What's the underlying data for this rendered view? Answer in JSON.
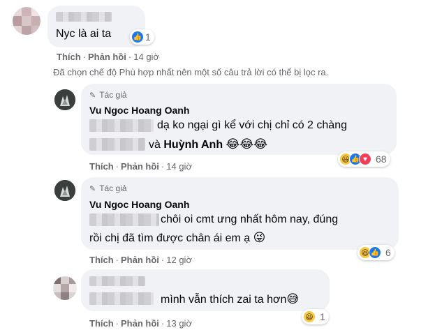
{
  "comment1": {
    "text": "Nyc là ai ta",
    "reaction_count": "1",
    "like_label": "Thích",
    "reply_label": "Phản hồi",
    "time": "14 giờ"
  },
  "filter_notice": "Đã chọn chế độ Phù hợp nhất nên một số câu trả lời có thể bị lọc ra.",
  "reply1": {
    "author_tag": "Tác giả",
    "author": "Vu Ngoc Hoang Oanh",
    "line1": "dạ ko ngại gì kể với chị chỉ có 2 chàng",
    "line2_prefix": "và",
    "mention": "Huỳnh Anh",
    "emojis": "😂😂😂",
    "reaction_count": "68",
    "like_label": "Thích",
    "reply_label": "Phản hồi",
    "time": "14 giờ"
  },
  "reply2": {
    "author_tag": "Tác giả",
    "author": "Vu Ngoc Hoang Oanh",
    "line1": "chôi oi cmt ưng nhất hôm nay, đúng",
    "line2": "rồi chị đã tìm được chân ái em ạ",
    "emoji": "😜",
    "reaction_count": "6",
    "like_label": "Thích",
    "reply_label": "Phản hồi",
    "time": "12 giờ"
  },
  "reply3": {
    "text": "mình vẫn thích zai ta hơn",
    "emoji": "😅",
    "reaction_count": "1",
    "like_label": "Thích",
    "reply_label": "Phản hồi",
    "time": "13 giờ"
  },
  "colors": {
    "bubble": "#f0f2f5",
    "secondary_text": "#65676b",
    "like_blue": "#1877f2"
  }
}
